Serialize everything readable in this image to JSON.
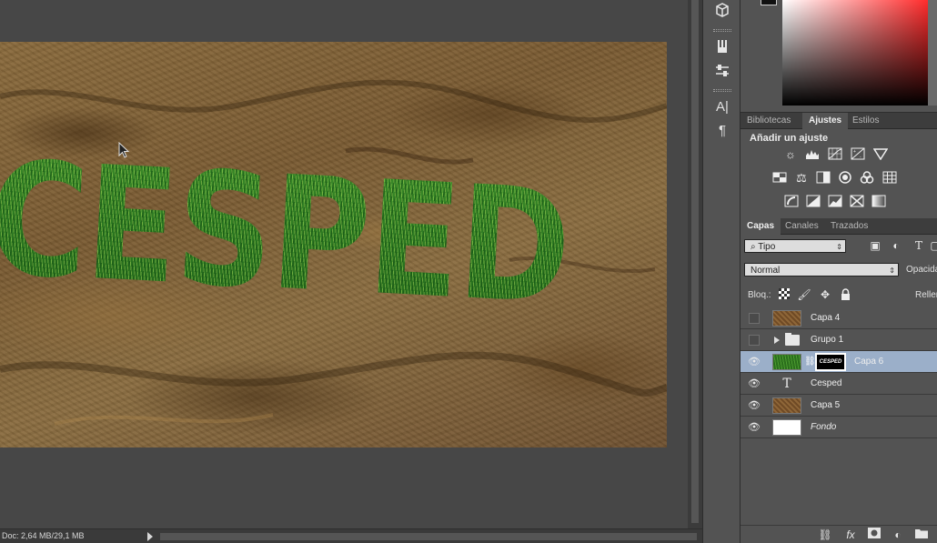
{
  "canvas": {
    "text": "CESPED",
    "doc_info": "Doc: 2,64 MB/29,1 MB"
  },
  "toolstrip": {
    "icons": [
      "3d-icon",
      "brush-presets-icon",
      "adjustments-sliders-icon",
      "character-icon",
      "paragraph-icon"
    ],
    "character_glyph": "A|",
    "paragraph_glyph": "¶"
  },
  "adjustments": {
    "tabs": [
      "Bibliotecas",
      "Ajustes",
      "Estilos"
    ],
    "active_tab": "Ajustes",
    "heading": "Añadir un ajuste"
  },
  "layers": {
    "tabs": [
      "Capas",
      "Canales",
      "Trazados"
    ],
    "active_tab": "Capas",
    "filter_kind": "Tipo",
    "blend_mode": "Normal",
    "opacity_label": "Opacidad:",
    "lock_label": "Bloq.:",
    "fill_label": "Relleno:",
    "items": [
      {
        "name": "Capa 4",
        "visible": false,
        "type": "dirt"
      },
      {
        "name": "Grupo 1",
        "visible": false,
        "type": "group"
      },
      {
        "name": "Capa 6",
        "visible": true,
        "type": "grass-masked",
        "selected": true,
        "mask_text": "CESPED"
      },
      {
        "name": "Cesped",
        "visible": true,
        "type": "text"
      },
      {
        "name": "Capa 5",
        "visible": true,
        "type": "dirt"
      },
      {
        "name": "Fondo",
        "visible": true,
        "type": "white",
        "italic": true
      }
    ]
  },
  "colors": {
    "panel_bg": "#535353",
    "selected_row": "#9bafc9",
    "grass": "#2d7a22",
    "dirt": "#8a6a3c"
  }
}
